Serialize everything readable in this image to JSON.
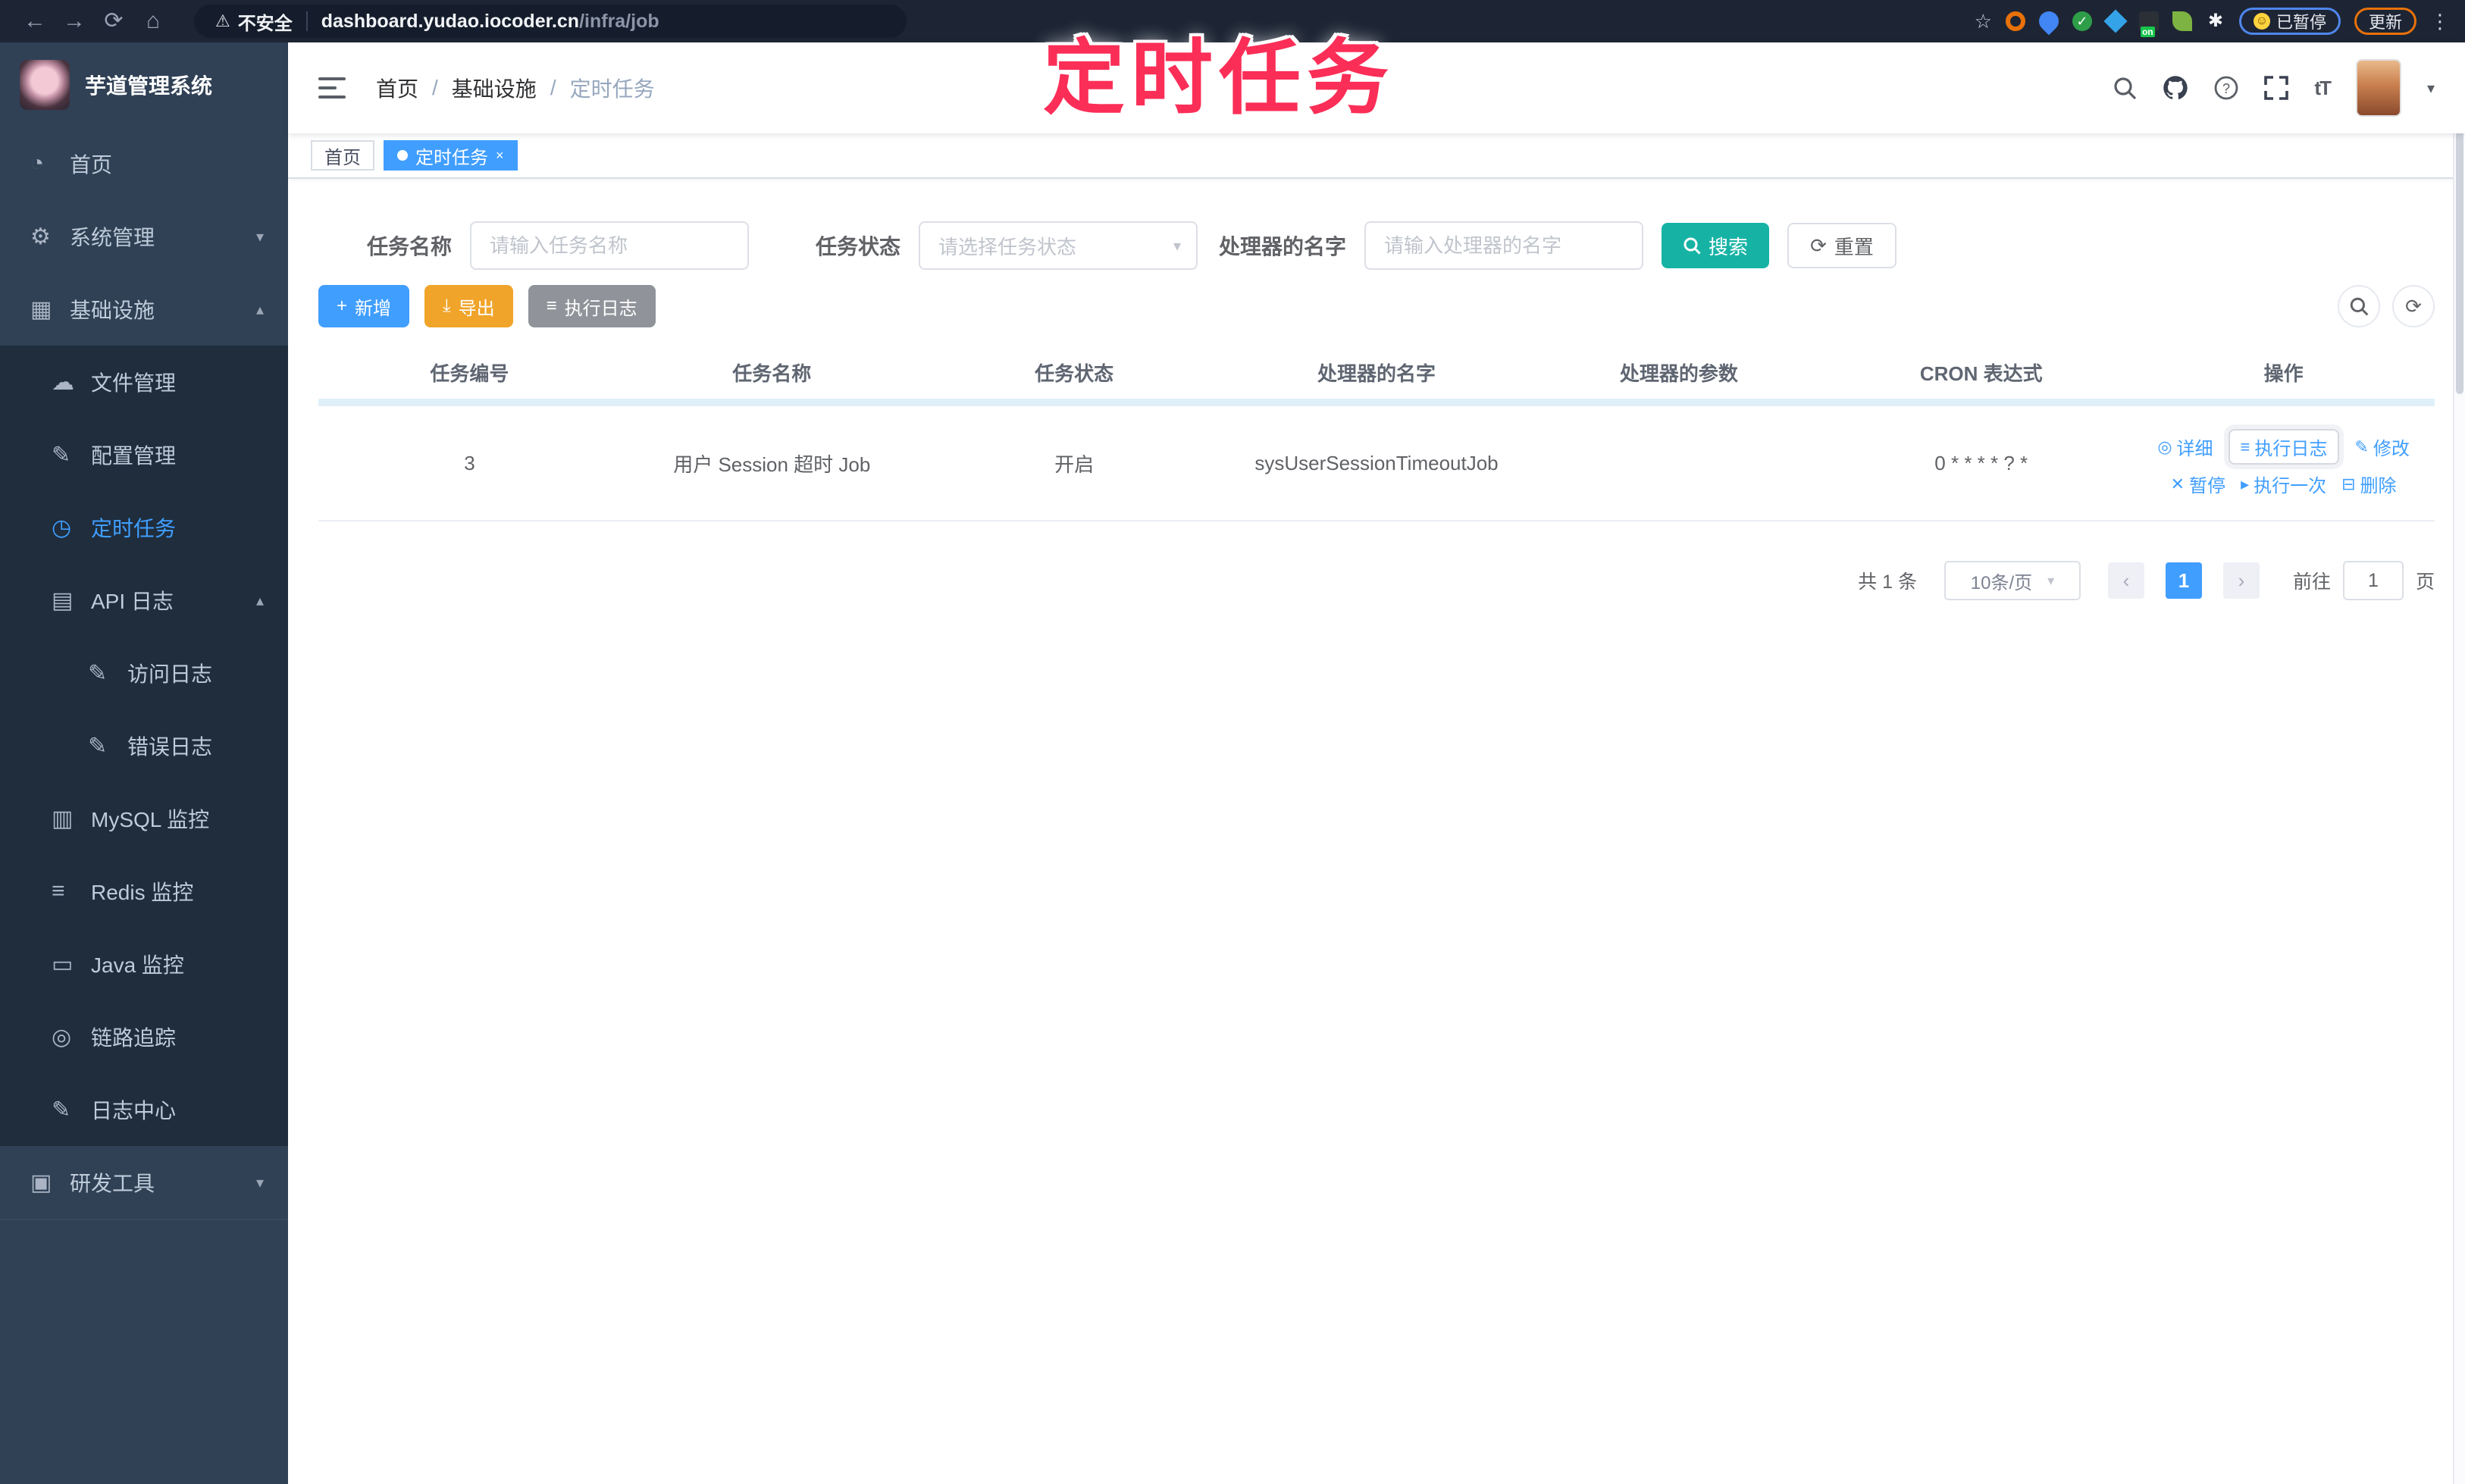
{
  "browser": {
    "security_label": "不安全",
    "url_host": "dashboard.yudao.iocoder.cn",
    "url_path": "/infra/job",
    "paused_label": "已暂停",
    "update_label": "更新"
  },
  "watermark": {
    "text": "定时任务",
    "color": "#fb2e57"
  },
  "icons": {
    "back": "←",
    "forward": "→",
    "reload": "⟳",
    "home_nav": "⌂",
    "warning": "⚠",
    "star": "☆",
    "dots": "⋮",
    "flower": "✱",
    "check": "✓",
    "smiley": "☺",
    "dashboard": "◔",
    "settings": "⚙",
    "infra": "▦",
    "file": "☁",
    "config": "✎",
    "job": "◷",
    "api_log": "▤",
    "access_log": "✎",
    "error_log": "✎",
    "mysql": "▥",
    "redis": "≡",
    "java": "▭",
    "trace": "◎",
    "log_center": "✎",
    "devtool": "▣",
    "chevron_down": "▾",
    "chevron_up": "▴",
    "plus": "+",
    "download": "⤓",
    "list": "≡",
    "refresh": "⟳",
    "eye": "◎",
    "edit": "✎",
    "pause": "✕",
    "play": "▸",
    "delete": "⊟",
    "prev": "‹",
    "next": "›",
    "caret": "▾",
    "font_size": "tT"
  },
  "sidebar": {
    "app_title": "芋道管理系统",
    "items": [
      {
        "label": "首页"
      },
      {
        "label": "系统管理"
      },
      {
        "label": "基础设施"
      },
      {
        "label": "文件管理"
      },
      {
        "label": "配置管理"
      },
      {
        "label": "定时任务"
      },
      {
        "label": "API 日志"
      },
      {
        "label": "访问日志"
      },
      {
        "label": "错误日志"
      },
      {
        "label": "MySQL 监控"
      },
      {
        "label": "Redis 监控"
      },
      {
        "label": "Java 监控"
      },
      {
        "label": "链路追踪"
      },
      {
        "label": "日志中心"
      },
      {
        "label": "研发工具"
      }
    ]
  },
  "breadcrumb": {
    "items": [
      "首页",
      "基础设施",
      "定时任务"
    ],
    "separator": "/"
  },
  "tabs": [
    {
      "label": "首页"
    },
    {
      "label": "定时任务",
      "close": "×"
    }
  ],
  "search": {
    "name_label": "任务名称",
    "name_placeholder": "请输入任务名称",
    "status_label": "任务状态",
    "status_placeholder": "请选择任务状态",
    "handler_label": "处理器的名字",
    "handler_placeholder": "请输入处理器的名字",
    "search_button": "搜索",
    "reset_button": "重置"
  },
  "toolbar": {
    "add_label": "新增",
    "export_label": "导出",
    "exec_log_label": "执行日志"
  },
  "table": {
    "headers": [
      "任务编号",
      "任务名称",
      "任务状态",
      "处理器的名字",
      "处理器的参数",
      "CRON 表达式",
      "操作"
    ],
    "rows": [
      {
        "id": "3",
        "name": "用户 Session 超时 Job",
        "status": "开启",
        "handler": "sysUserSessionTimeoutJob",
        "params": "",
        "cron": "0 * * * * ? *",
        "actions": [
          "详细",
          "执行日志",
          "修改",
          "暂停",
          "执行一次",
          "删除"
        ]
      }
    ]
  },
  "pagination": {
    "total": "共 1 条",
    "page_size": "10条/页",
    "current_page": "1",
    "goto_label": "前往",
    "goto_value": "1",
    "page_label": "页"
  },
  "colors": {
    "accent_blue": "#409EFF",
    "accent_teal": "#16b3a5",
    "accent_orange": "#f0a42a",
    "accent_gray": "#909399",
    "sidebar_bg": "#304156",
    "submenu_bg": "#1f2d3d",
    "chrome_bg": "#1d2534",
    "watermark_pink": "#fb2e57"
  }
}
